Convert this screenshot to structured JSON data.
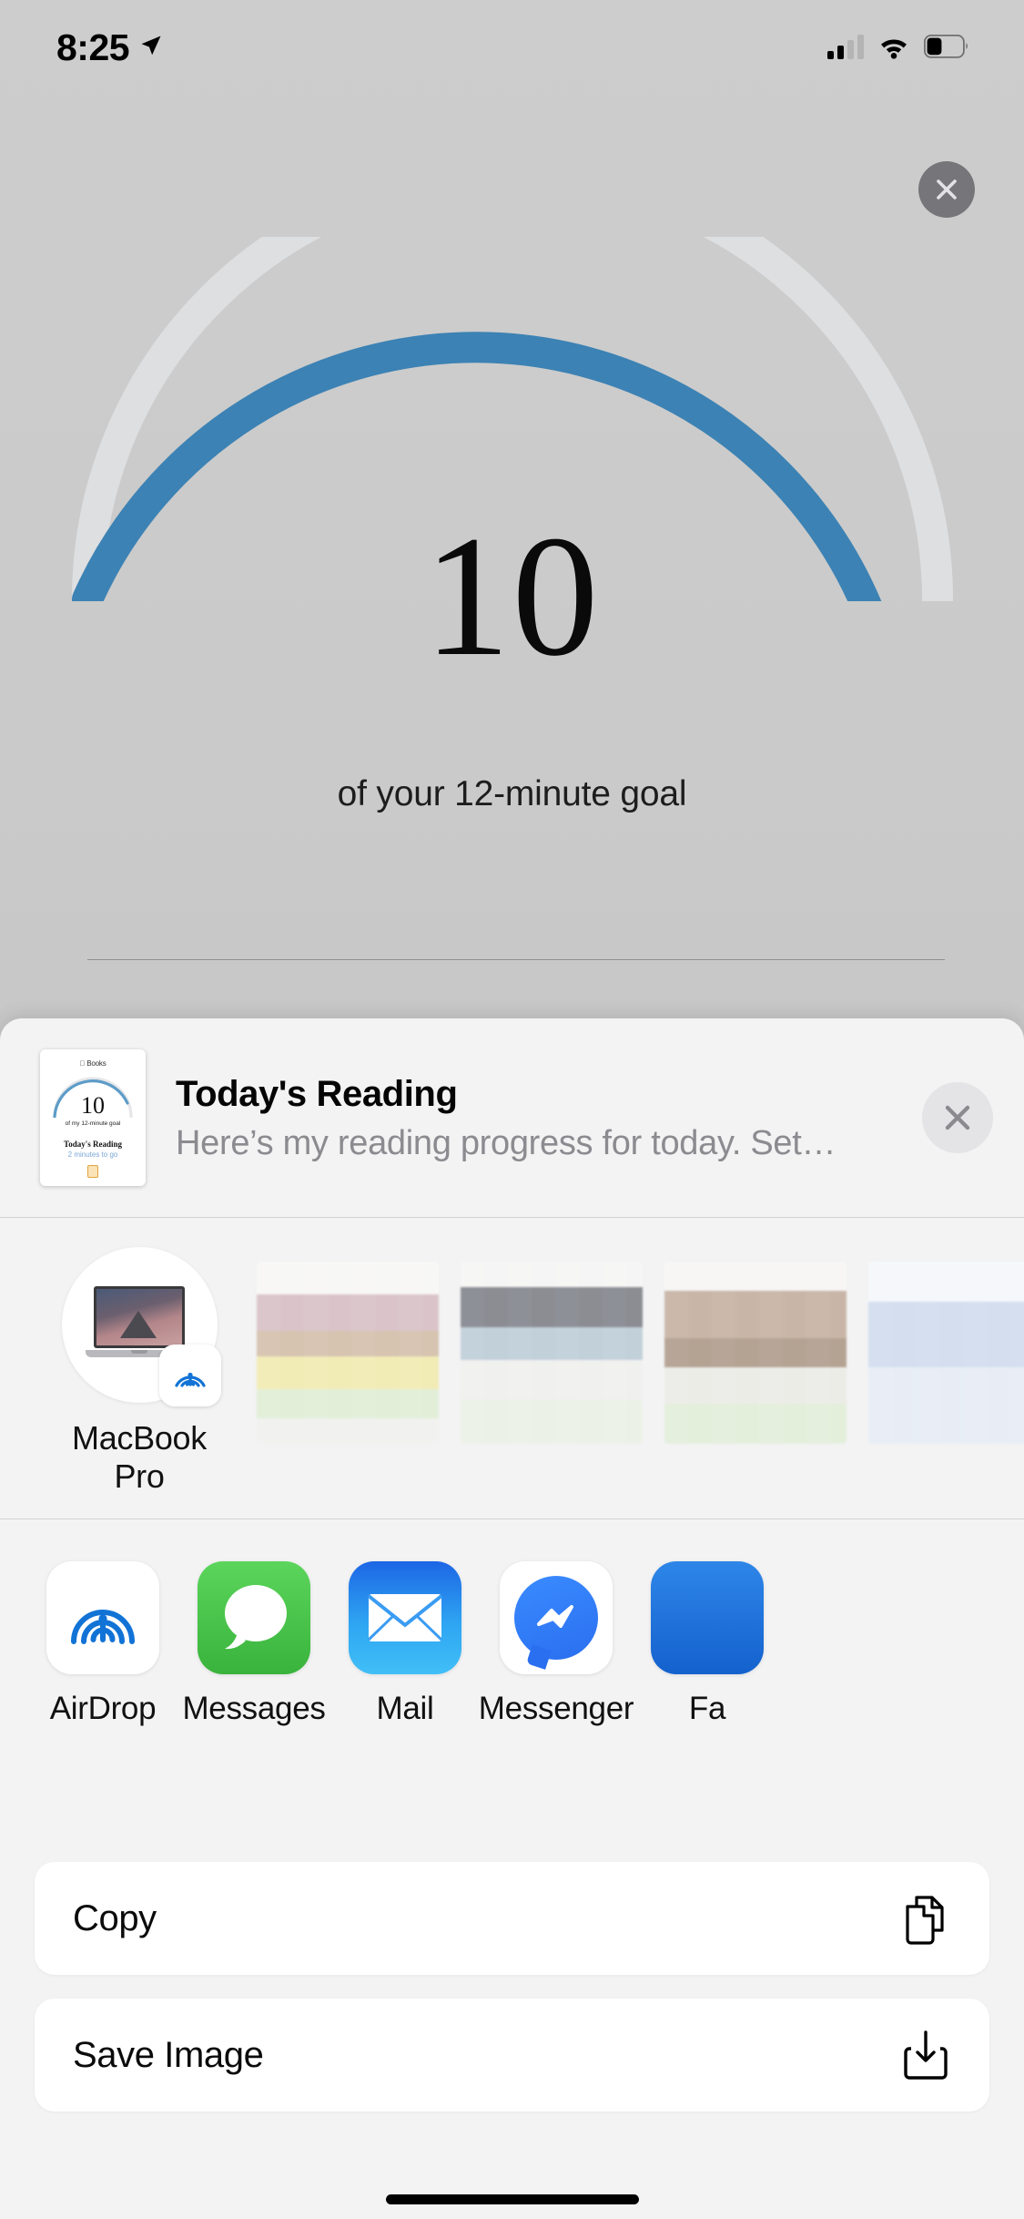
{
  "status_bar": {
    "time": "8:25",
    "location_icon": "location-arrow-icon",
    "signal_icon": "cellular-signal-icon",
    "signal_bars_filled": 2,
    "signal_bars_total": 4,
    "wifi_icon": "wifi-icon",
    "battery_icon": "battery-icon",
    "battery_level_percent": 40
  },
  "backdrop": {
    "close_label": "×",
    "gauge": {
      "value": "10",
      "caption": "of your 12-minute goal",
      "goal_minutes": 12,
      "progress_percent": 83,
      "arc_color": "#3c82b4",
      "track_color": "#dedfe1"
    }
  },
  "share_sheet": {
    "preview": {
      "title": "Today's Reading",
      "subtitle": "Here’s my reading progress for today. Set…",
      "close_label": "✕",
      "thumbnail": {
        "brand": " Books",
        "value": "10",
        "caption": "of my 12-minute goal",
        "title": "Today's Reading",
        "remaining": "2 minutes to go",
        "book_icon": "book-icon"
      }
    },
    "airdrop": {
      "targets": [
        {
          "name": "MacBook\nPro",
          "name_line1": "MacBook",
          "name_line2": "Pro",
          "device_icon": "macbook-icon",
          "badge_icon": "airdrop-icon"
        }
      ],
      "blurred_photos": 4
    },
    "apps": [
      {
        "label": "AirDrop",
        "icon": "airdrop-icon",
        "color": "#ffffff"
      },
      {
        "label": "Messages",
        "icon": "messages-icon",
        "color": "#43c043"
      },
      {
        "label": "Mail",
        "icon": "mail-icon",
        "color": "#2b8ef0"
      },
      {
        "label": "Messenger",
        "icon": "messenger-icon",
        "color": "#3a8bff"
      },
      {
        "label": "Fa",
        "icon": "facebook-icon",
        "color": "#1877f2"
      }
    ],
    "actions": [
      {
        "label": "Copy",
        "icon": "copy-icon"
      },
      {
        "label": "Save Image",
        "icon": "save-download-icon"
      }
    ]
  }
}
